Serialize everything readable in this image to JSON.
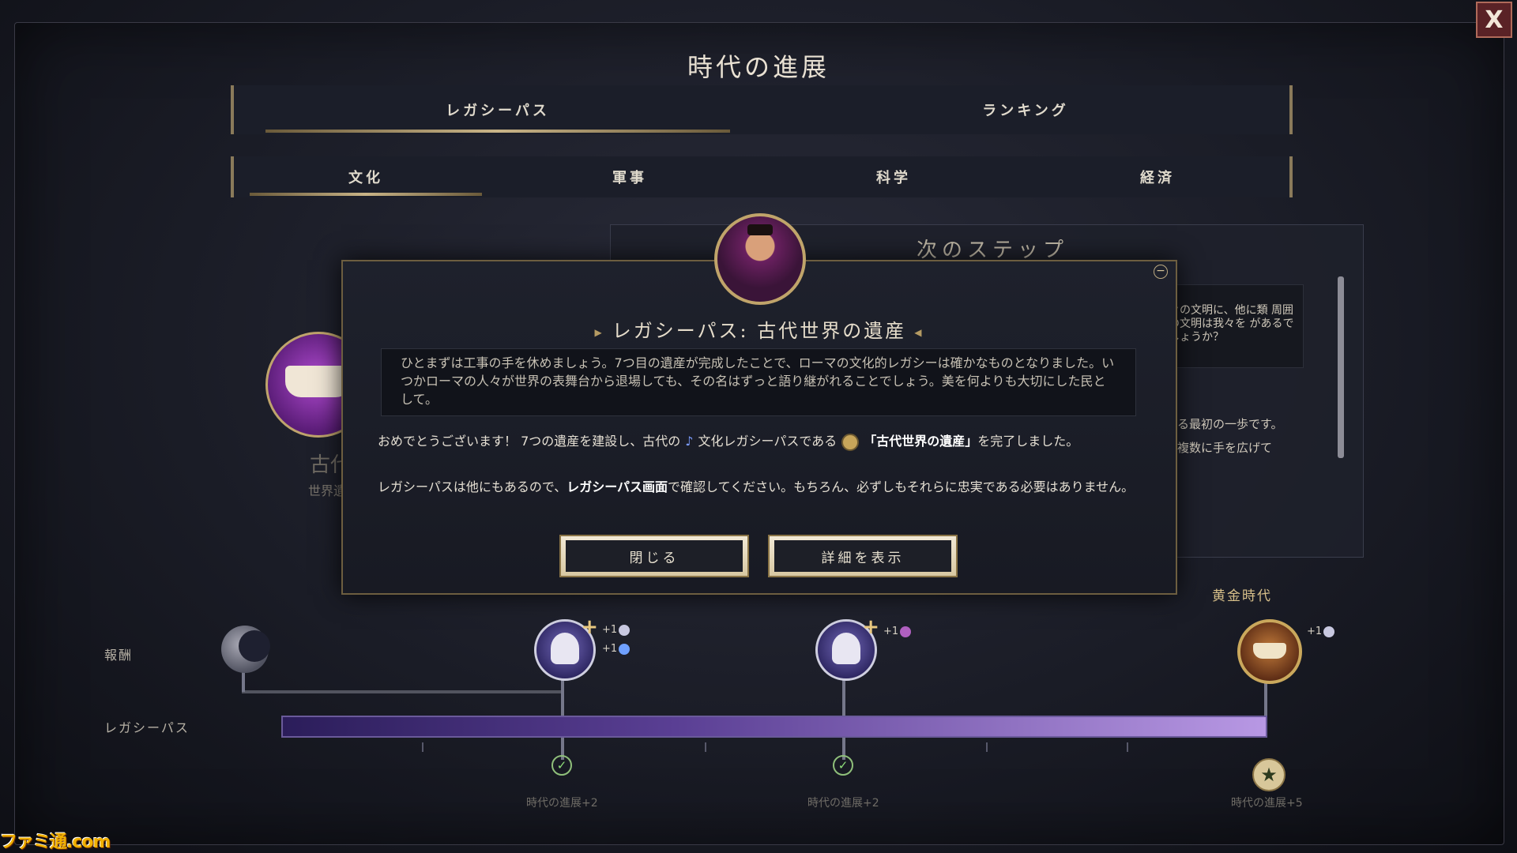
{
  "window": {
    "title": "時代の進展",
    "close_label": "X"
  },
  "main_tabs": [
    {
      "label": "レガシーパス",
      "active": true
    },
    {
      "label": "ランキング",
      "active": false
    }
  ],
  "sub_tabs": [
    {
      "label": "文化",
      "active": true
    },
    {
      "label": "軍事",
      "active": false
    },
    {
      "label": "科学",
      "active": false
    },
    {
      "label": "経済",
      "active": false
    }
  ],
  "background": {
    "next_step_title": "次のステップ",
    "quote_text": "々の文明に、他に類 周囲の文明は我々を があるでしょうか？",
    "side_text_1": "る最初の一歩です。",
    "side_text_2": "複数に手を広げて",
    "legacy_name_faded": "古代",
    "legacy_sub_faded": "世界遺"
  },
  "modal": {
    "title": "レガシーパス: 古代世界の遺産",
    "flavor": "ひとまずは工事の手を休めましょう。7つ目の遺産が完成したことで、ローマの文化的レガシーは確かなものとなりました。いつかローマの人々が世界の表舞台から退場しても、その名はずっと語り継がれることでしょう。美を何よりも大切にした民として。",
    "para1_a": "おめでとうございます！ 7つの遺産を建設し、古代の",
    "para1_b": "文化レガシーパスである",
    "para1_c": "「古代世界の遺産」",
    "para1_d": "を完了しました。",
    "para2_a": "レガシーパスは他にもあるので、",
    "para2_b": "レガシーパス画面",
    "para2_c": "で確認してください。もちろん、必ずしもそれらに忠実である必要はありません。",
    "btn_close": "閉じる",
    "btn_details": "詳細を表示"
  },
  "track": {
    "reward_label": "報酬",
    "legacy_label": "レガシーパス",
    "golden_age": "黄金時代",
    "rewards": [
      {
        "lines": [
          "+1",
          "+1"
        ]
      },
      {
        "lines": [
          "+1"
        ]
      },
      {
        "lines": [
          "+1"
        ]
      }
    ],
    "milestones": [
      {
        "era_text": "時代の進展+2"
      },
      {
        "era_text": "時代の進展+2"
      },
      {
        "era_text": "時代の進展+5"
      }
    ]
  },
  "watermark": "ファミ通.com",
  "colors": {
    "accent_gold": "#c9b487",
    "progress_start": "#2b1d5a",
    "progress_end": "#b898e4",
    "close_red": "#5a2226"
  }
}
